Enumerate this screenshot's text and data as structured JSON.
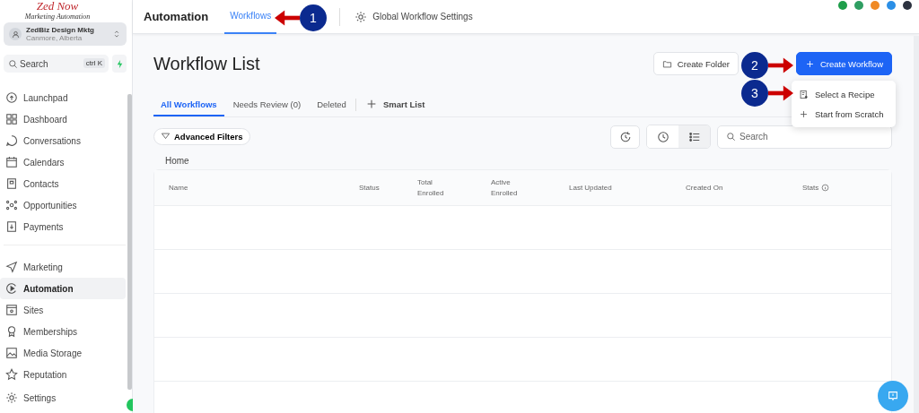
{
  "logo": {
    "name": "Zed Now",
    "tagline": "Marketing Automation"
  },
  "account": {
    "name": "ZedBiz Design Mktg",
    "location": "Canmore, Alberta"
  },
  "sidebar_search": {
    "placeholder": "Search",
    "shortcut": "ctrl K"
  },
  "sidebar": {
    "groups": [
      [
        {
          "label": "Launchpad",
          "selected": false
        },
        {
          "label": "Dashboard",
          "selected": false
        },
        {
          "label": "Conversations",
          "selected": false
        },
        {
          "label": "Calendars",
          "selected": false
        },
        {
          "label": "Contacts",
          "selected": false
        },
        {
          "label": "Opportunities",
          "selected": false
        },
        {
          "label": "Payments",
          "selected": false
        }
      ],
      [
        {
          "label": "Marketing",
          "selected": false
        },
        {
          "label": "Automation",
          "selected": true
        },
        {
          "label": "Sites",
          "selected": false
        },
        {
          "label": "Memberships",
          "selected": false
        },
        {
          "label": "Media Storage",
          "selected": false
        },
        {
          "label": "Reputation",
          "selected": false
        }
      ],
      [
        {
          "label": "Settings",
          "selected": false
        }
      ]
    ]
  },
  "header": {
    "title": "Automation",
    "tabs": [
      {
        "label": "Workflows",
        "selected": true
      }
    ],
    "settings_link": "Global Workflow Settings",
    "avatars": [
      {
        "color": "#1e9e4a"
      },
      {
        "color": "#2f9e62"
      },
      {
        "color": "#f08a24"
      },
      {
        "color": "#2b8fe6"
      },
      {
        "color": "#2d3340"
      }
    ]
  },
  "page": {
    "title": "Workflow List",
    "buttons": [
      {
        "label": "Create Folder",
        "kind": "secondary"
      },
      {
        "label": "Create Workflow",
        "kind": "primary"
      }
    ],
    "menu": [
      {
        "label": "Select a Recipe"
      },
      {
        "label": "Start from Scratch"
      }
    ],
    "tabs": [
      {
        "label": "All Workflows",
        "selected": true
      },
      {
        "label": "Needs Review (0)",
        "selected": false
      },
      {
        "label": "Deleted",
        "selected": false
      }
    ],
    "smart_list": "Smart List",
    "filters": "Advanced Filters",
    "view_toggle": [
      {
        "selected": false
      },
      {
        "selected": true
      }
    ],
    "search": {
      "placeholder": "Search"
    },
    "breadcrumb": "Home",
    "table": {
      "columns": [
        "Name",
        "Status",
        "Total\nEnrolled",
        "Active\nEnrolled",
        "Last Updated",
        "Created On",
        "Stats"
      ]
    }
  },
  "callouts": [
    {
      "number": "1",
      "kind": "left"
    },
    {
      "number": "2",
      "kind": "right"
    },
    {
      "number": "3",
      "kind": "right"
    }
  ]
}
